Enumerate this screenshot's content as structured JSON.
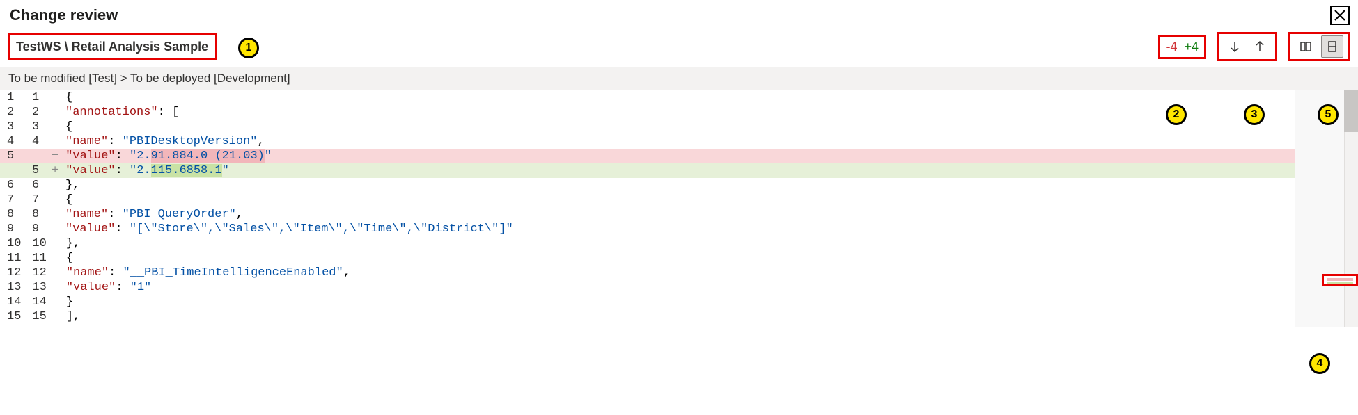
{
  "header": {
    "title": "Change review"
  },
  "toolbar": {
    "breadcrumb": "TestWS \\ Retail Analysis Sample",
    "removed_count": "-4",
    "added_count": "+4"
  },
  "subheader": {
    "text": "To be modified [Test] > To be deployed [Development]"
  },
  "callouts": {
    "c1": "1",
    "c2": "2",
    "c3": "3",
    "c4": "4",
    "c5": "5"
  },
  "diff": {
    "lines": [
      {
        "lnL": "1",
        "lnR": "1",
        "sign": "",
        "bg": "",
        "tokens": [
          [
            "t-brace",
            "{"
          ]
        ]
      },
      {
        "lnL": "2",
        "lnR": "2",
        "sign": "",
        "bg": "",
        "tokens": [
          [
            "",
            "  "
          ],
          [
            "t-key",
            "\"annotations\""
          ],
          [
            "t-punc",
            ": ["
          ]
        ]
      },
      {
        "lnL": "3",
        "lnR": "3",
        "sign": "",
        "bg": "",
        "tokens": [
          [
            "",
            "    "
          ],
          [
            "t-brace",
            "{"
          ]
        ]
      },
      {
        "lnL": "4",
        "lnR": "4",
        "sign": "",
        "bg": "",
        "tokens": [
          [
            "",
            "      "
          ],
          [
            "t-key",
            "\"name\""
          ],
          [
            "t-punc",
            ": "
          ],
          [
            "t-str",
            "\"PBIDesktopVersion\""
          ],
          [
            "t-punc",
            ","
          ]
        ]
      },
      {
        "lnL": "5",
        "lnR": "",
        "sign": "−",
        "bg": "removed",
        "tokens": [
          [
            "",
            "      "
          ],
          [
            "t-key",
            "\"value\""
          ],
          [
            "t-punc",
            ": "
          ],
          [
            "t-str",
            "\"2."
          ],
          [
            "t-str inline-removed",
            "91.884.0 (21.03)"
          ],
          [
            "t-str",
            "\""
          ]
        ]
      },
      {
        "lnL": "",
        "lnR": "5",
        "sign": "+",
        "bg": "added",
        "tokens": [
          [
            "",
            "      "
          ],
          [
            "t-key",
            "\"value\""
          ],
          [
            "t-punc",
            ": "
          ],
          [
            "t-str",
            "\"2."
          ],
          [
            "t-str inline-added",
            "115.6858.1"
          ],
          [
            "t-str",
            "\""
          ]
        ]
      },
      {
        "lnL": "6",
        "lnR": "6",
        "sign": "",
        "bg": "",
        "tokens": [
          [
            "",
            "    "
          ],
          [
            "t-brace",
            "},"
          ]
        ]
      },
      {
        "lnL": "7",
        "lnR": "7",
        "sign": "",
        "bg": "",
        "tokens": [
          [
            "",
            "    "
          ],
          [
            "t-brace",
            "{"
          ]
        ]
      },
      {
        "lnL": "8",
        "lnR": "8",
        "sign": "",
        "bg": "",
        "tokens": [
          [
            "",
            "      "
          ],
          [
            "t-key",
            "\"name\""
          ],
          [
            "t-punc",
            ": "
          ],
          [
            "t-str",
            "\"PBI_QueryOrder\""
          ],
          [
            "t-punc",
            ","
          ]
        ]
      },
      {
        "lnL": "9",
        "lnR": "9",
        "sign": "",
        "bg": "",
        "tokens": [
          [
            "",
            "      "
          ],
          [
            "t-key",
            "\"value\""
          ],
          [
            "t-punc",
            ": "
          ],
          [
            "t-str",
            "\"[\\\"Store\\\",\\\"Sales\\\",\\\"Item\\\",\\\"Time\\\",\\\"District\\\"]\""
          ]
        ]
      },
      {
        "lnL": "10",
        "lnR": "10",
        "sign": "",
        "bg": "",
        "tokens": [
          [
            "",
            "    "
          ],
          [
            "t-brace",
            "},"
          ]
        ]
      },
      {
        "lnL": "11",
        "lnR": "11",
        "sign": "",
        "bg": "",
        "tokens": [
          [
            "",
            "    "
          ],
          [
            "t-brace",
            "{"
          ]
        ]
      },
      {
        "lnL": "12",
        "lnR": "12",
        "sign": "",
        "bg": "",
        "tokens": [
          [
            "",
            "      "
          ],
          [
            "t-key",
            "\"name\""
          ],
          [
            "t-punc",
            ": "
          ],
          [
            "t-str",
            "\"__PBI_TimeIntelligenceEnabled\""
          ],
          [
            "t-punc",
            ","
          ]
        ]
      },
      {
        "lnL": "13",
        "lnR": "13",
        "sign": "",
        "bg": "",
        "tokens": [
          [
            "",
            "      "
          ],
          [
            "t-key",
            "\"value\""
          ],
          [
            "t-punc",
            ": "
          ],
          [
            "t-str",
            "\"1\""
          ]
        ]
      },
      {
        "lnL": "14",
        "lnR": "14",
        "sign": "",
        "bg": "",
        "tokens": [
          [
            "",
            "    "
          ],
          [
            "t-brace",
            "}"
          ]
        ]
      },
      {
        "lnL": "15",
        "lnR": "15",
        "sign": "",
        "bg": "",
        "tokens": [
          [
            "",
            "  "
          ],
          [
            "t-brace",
            "],"
          ]
        ]
      }
    ]
  }
}
